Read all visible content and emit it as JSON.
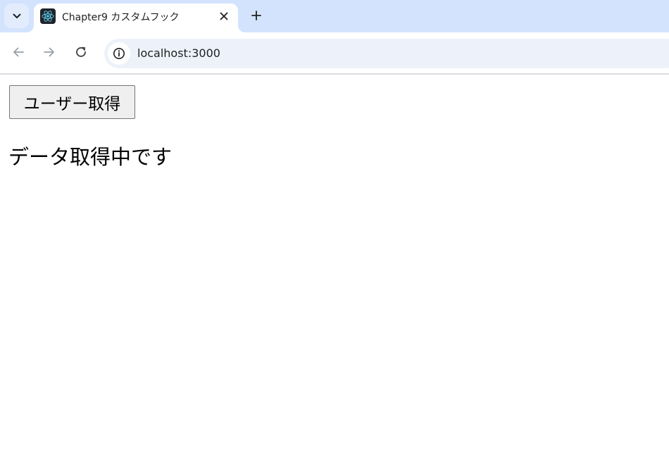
{
  "browser": {
    "tab": {
      "title": "Chapter9 カスタムフック",
      "favicon": "react-logo-icon"
    },
    "address_bar": {
      "url": "localhost:3000"
    },
    "colors": {
      "tabstrip": "#d3e3fd",
      "omnibox": "#edf2fa",
      "react_cyan": "#61dafb"
    },
    "icons": {
      "tab_search": "chevron-down-icon",
      "close_tab": "close-icon",
      "new_tab": "plus-icon",
      "back": "arrow-left-icon",
      "forward": "arrow-right-icon",
      "reload": "reload-icon",
      "site_info": "info-icon"
    }
  },
  "page": {
    "fetch_button_label": "ユーザー取得",
    "status_text": "データ取得中です"
  }
}
